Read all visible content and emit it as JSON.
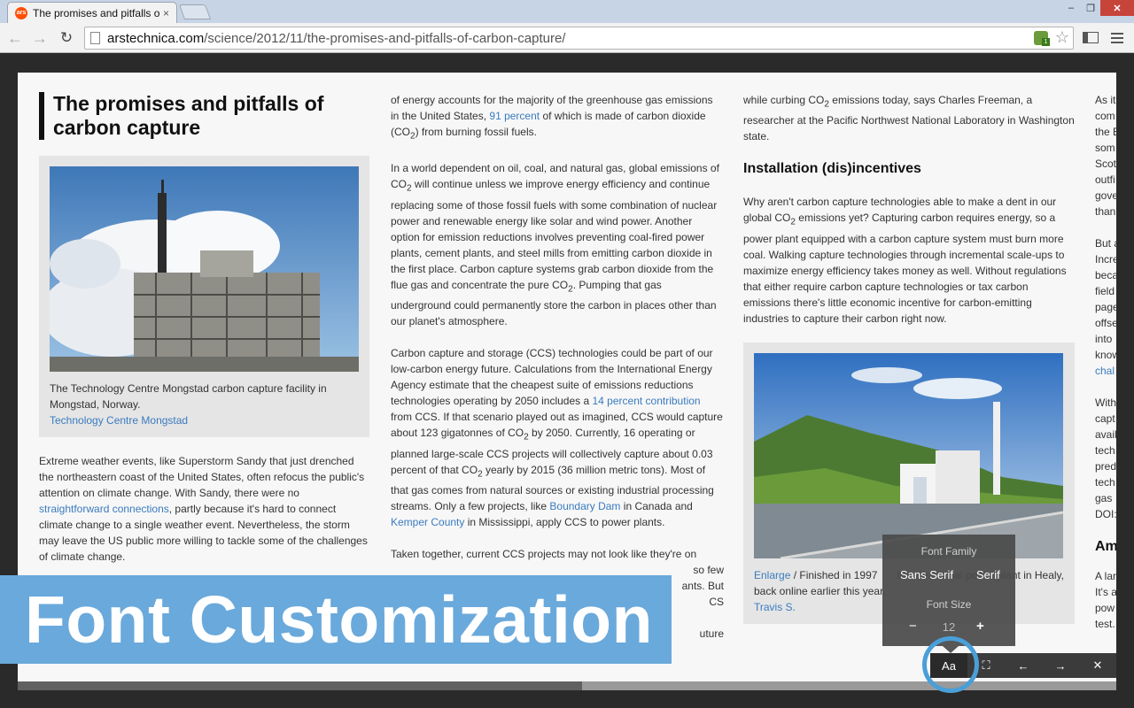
{
  "browser": {
    "tab_title": "The promises and pitfalls of carbon capture",
    "tab_favicon": "ars",
    "url_host": "arstechnica.com",
    "url_path": "/science/2012/11/the-promises-and-pitfalls-of-carbon-capture/",
    "window_controls": {
      "minimize": "–",
      "maximize": "❐",
      "close": "✕"
    }
  },
  "article": {
    "headline": "The promises and pitfalls of carbon capture",
    "figure1": {
      "caption": "The Technology Centre Mongstad carbon capture facility in Mongstad, Norway.",
      "credit": "Technology Centre Mongstad"
    },
    "col1_p1": {
      "a": "Extreme weather events, like Superstorm Sandy that just drenched the northeastern coast of the United States, often refocus the public's attention on climate change. With Sandy, there were no ",
      "link": "straightforward connections",
      "b": ", partly because it's hard to connect climate change to a single weather event. Nevertheless, the storm may leave the US public more willing to tackle some of the challenges of climate change."
    },
    "col2_p1": {
      "a": "of energy accounts for the majority of the greenhouse gas emissions in the United States, ",
      "link": "91 percent",
      "b": " of which is made of carbon dioxide (CO",
      "sub": "2",
      "c": ") from burning fossil fuels."
    },
    "col2_p2": {
      "a": "In a world dependent on oil, coal, and natural gas, global emissions of CO",
      "sub": "2",
      "b": " will continue unless we improve energy efficiency and continue replacing some of those fossil fuels with some combination of nuclear power and renewable energy like solar and wind power. Another option for emission reductions involves preventing coal-fired power plants, cement plants, and steel mills from emitting carbon dioxide in the first place. Carbon capture systems grab carbon dioxide from the flue gas and concentrate the pure CO",
      "sub2": "2",
      "c": ". Pumping that gas underground could permanently store the carbon in places other than our planet's atmosphere."
    },
    "col2_p3": {
      "a": "Carbon capture and storage (CCS) technologies could be part of our low-carbon energy future. Calculations from the International Energy Agency estimate that the cheapest suite of emissions reductions technologies operating by 2050 includes a ",
      "link": "14 percent contribution",
      "b": " from CCS. If that scenario played out as imagined, CCS would capture about 123 gigatonnes of CO",
      "sub": "2",
      "c": " by 2050. Currently, 16 operating or planned large-scale CCS projects will collectively capture about 0.03 percent of that CO",
      "sub2": "2",
      "d": " yearly by 2015 (36 million metric tons). Most of that gas comes from natural sources or existing industrial processing streams. Only a few projects, like ",
      "link2": "Boundary Dam",
      "e": " in Canada and ",
      "link3": "Kemper County",
      "f": " in Mississippi, apply CCS to power plants."
    },
    "col2_p4": {
      "l1": "Taken together, current CCS projects may not look like they're on",
      "l2": "so few",
      "l3": "ants. But",
      "l4": "CS",
      "l5": "",
      "l6": "uture"
    },
    "col3_p1": {
      "a": "while curbing CO",
      "sub": "2",
      "b": " emissions today, says Charles Freeman, a researcher at the Pacific Northwest National Laboratory in Washington state."
    },
    "col3_h3": "Installation (dis)incentives",
    "col3_p2": {
      "a": "Why aren't carbon capture technologies able to make a dent in our global CO",
      "sub": "2",
      "b": " emissions yet? Capturing carbon requires energy, so a power plant equipped with a carbon capture system must burn more coal. Walking capture technologies through incremental scale-ups to maximize energy efficiency takes money as well. Without regulations that either require carbon capture technologies or tax carbon emissions there's little economic incentive for carbon-emitting industries to capture their carbon right now."
    },
    "figure2": {
      "enlarge": "Enlarge",
      "caption_a": " / Finished in 1997",
      "caption_b": "the clean coal power plant in Healy,",
      "caption_c": "back online earlier this year.",
      "credit": "Travis S."
    },
    "col4": {
      "l1": "As it",
      "l2": "com",
      "l3": "the E",
      "l4": "som",
      "l5": "Scot",
      "l6": "outfi",
      "l7": "gove",
      "l8": "than",
      "l9": "But a",
      "l10": "Incre",
      "l11": "beca",
      "l12": "field",
      "l13": "page",
      "l14": "offse",
      "l15": "into",
      "l16": "know",
      "l17": "chal",
      "l18": "With",
      "l19": "capt",
      "l20": "avail",
      "l21": "tech",
      "l22": "pred",
      "l23": "tech",
      "l24": "gas",
      "l25": "DOI:",
      "h3": "Am",
      "l26": "A lar",
      "l27": "It's a",
      "l28": "pow",
      "l29": "test."
    }
  },
  "reader_controls": {
    "font_button": "Aa",
    "fullscreen_icon": "⛶",
    "prev_icon": "←",
    "next_icon": "→",
    "close_icon": "✕",
    "progress_fraction": 0.514
  },
  "font_panel": {
    "family_title": "Font Family",
    "sans_option": "Sans Serif",
    "serif_option": "Serif",
    "size_title": "Font Size",
    "minus": "−",
    "size_value": "12",
    "plus": "+"
  },
  "overlay_banner": "Font Customization",
  "colors": {
    "accent": "#6aa9db",
    "link": "#3a7bbf",
    "ring": "#4a9fd8"
  }
}
